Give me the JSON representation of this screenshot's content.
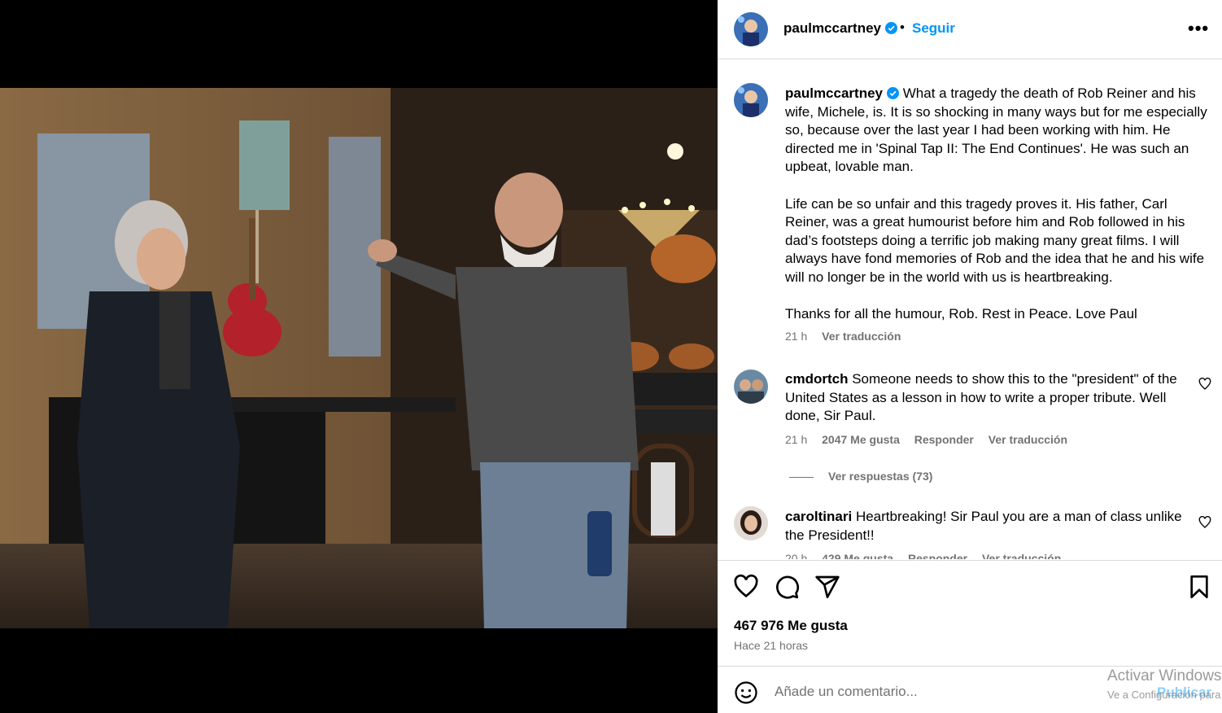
{
  "post": {
    "author": "paulmccartney",
    "separator": "•",
    "follow_label": "Seguir",
    "more_label": "•••",
    "caption": {
      "username": "paulmccartney",
      "paragraphs": [
        "What a tragedy the death of Rob Reiner and his wife, Michele, is. It is so shocking in many ways but for me especially so, because over the last year I had been working with him. He directed me in 'Spinal Tap II: The End Continues'. He was such an upbeat, lovable man.",
        "Life can be so unfair and this tragedy proves it. His father, Carl Reiner, was a great humourist before him and Rob followed in his dad’s footsteps doing a terrific job making many great films. I will always have fond memories of Rob and the idea that he and his wife will no longer be in the world with us is heartbreaking.",
        "Thanks for all the humour, Rob. Rest in Peace. Love Paul"
      ],
      "time": "21 h",
      "translate": "Ver traducción"
    },
    "comments": [
      {
        "username": "cmdortch",
        "text": "Someone needs to show this to the \"president\" of the United States as a lesson in how to write a proper tribute. Well done, Sir Paul.",
        "time": "21 h",
        "likes": "2047 Me gusta",
        "reply": "Responder",
        "translate": "Ver traducción",
        "view_replies": "Ver respuestas (73)"
      },
      {
        "username": "caroltinari",
        "text": "Heartbreaking! Sir Paul you are a man of class unlike the President!!",
        "time": "20 h",
        "likes": "429 Me gusta",
        "reply": "Responder",
        "translate": "Ver traducción"
      }
    ],
    "likes_count": "467 976 Me gusta",
    "posted_ago": "Hace 21 horas",
    "comment_placeholder": "Añade un comentario...",
    "publish_label": "Publicar"
  },
  "icons": [
    "verified-badge-icon",
    "heart-icon",
    "comment-icon",
    "share-icon",
    "bookmark-icon",
    "emoji-icon",
    "more-options-icon"
  ],
  "colors": {
    "accent": "#0095f6",
    "muted": "#737373",
    "border": "#dbdbdb",
    "background_left": "#000000"
  },
  "watermark": {
    "line1": "Activar Windows",
    "line2": "Ve a Configuración para activar Windows."
  }
}
